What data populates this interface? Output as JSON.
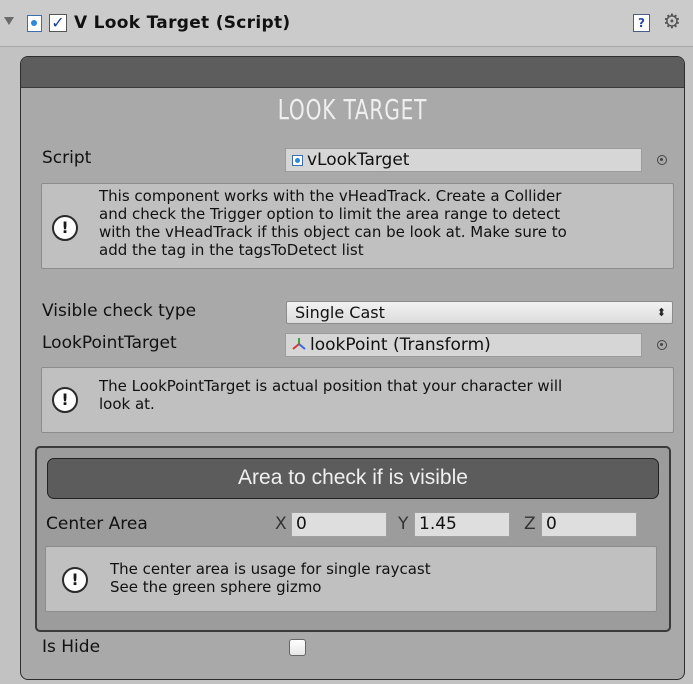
{
  "header": {
    "title": "V Look Target (Script)",
    "enabled": true
  },
  "panel": {
    "title": "LOOK TARGET",
    "script": {
      "label": "Script",
      "value": "vLookTarget"
    },
    "help1": "This component works with the vHeadTrack. Create a Collider\nand check the Trigger option to limit the area range to detect\nwith the vHeadTrack if this object can be look at. Make sure to\nadd the tag in the tagsToDetect list",
    "visible_check": {
      "label": "Visible check type",
      "value": "Single Cast"
    },
    "look_point": {
      "label": "LookPointTarget",
      "value": "lookPoint (Transform)"
    },
    "help2": "The LookPointTarget is actual position that your character will\nlook at.",
    "area": {
      "button_label": "Area to check if is visible",
      "center_label": "Center Area",
      "x_label": "X",
      "x": "0",
      "y_label": "Y",
      "y": "1.45",
      "z_label": "Z",
      "z": "0",
      "help": "The center area is usage for single raycast\n See the green sphere gizmo"
    },
    "is_hide": {
      "label": "Is Hide",
      "checked": false
    }
  },
  "icons": {
    "fold": "triangle-down-icon",
    "script": "script-icon",
    "help": "help-book-icon",
    "gear": "gear-icon",
    "warning": "exclamation-icon",
    "picker": "object-picker-icon",
    "transform": "transform-axes-icon"
  }
}
